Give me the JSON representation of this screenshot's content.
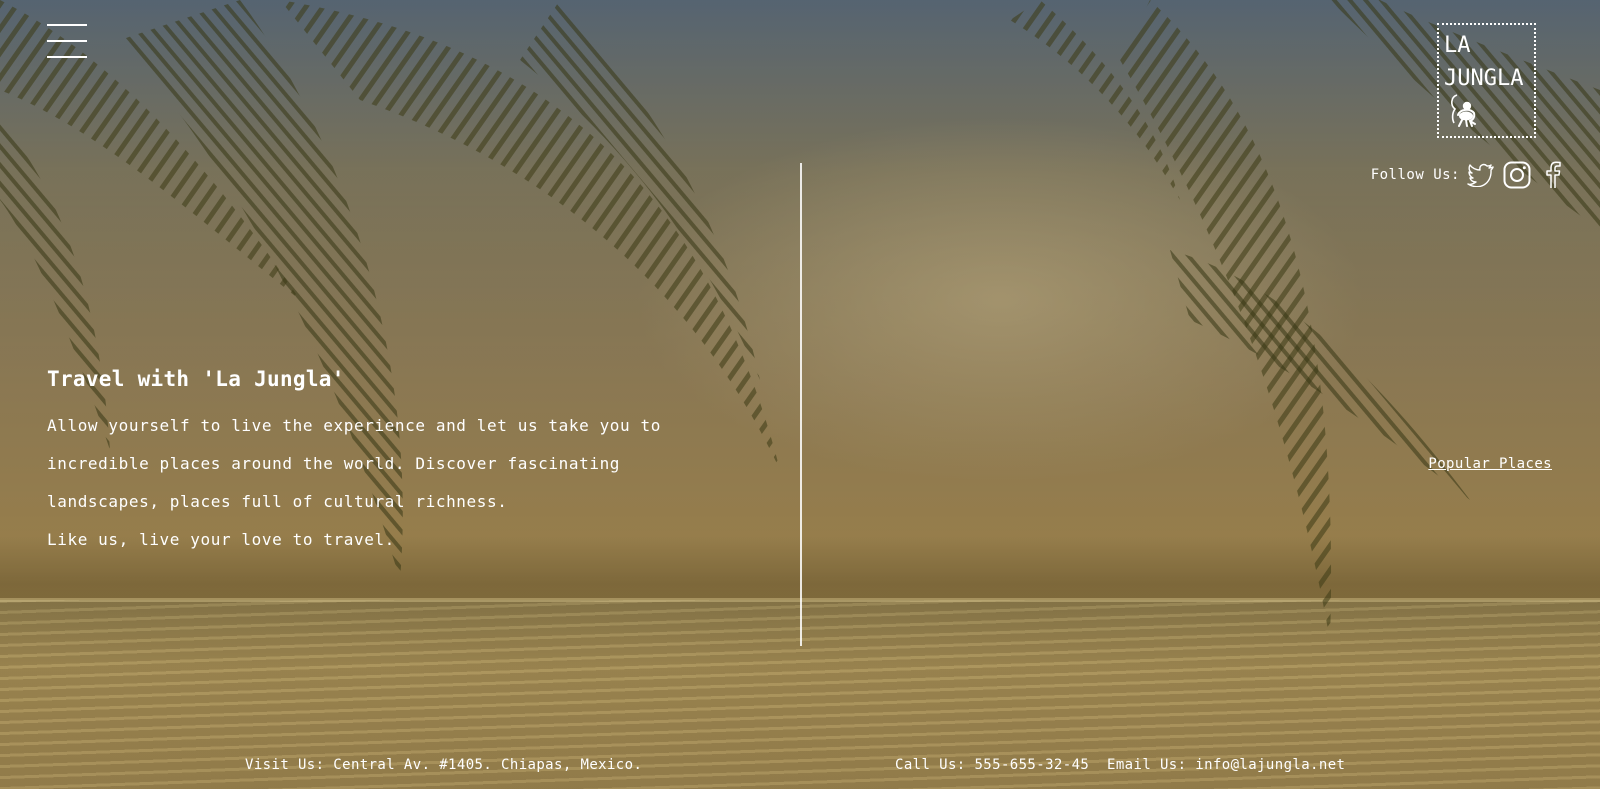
{
  "header": {
    "menu_icon": "hamburger-menu-icon",
    "logo": {
      "line1": "LA",
      "line2": "JUNGLA",
      "mascot_icon": "monkey-icon"
    }
  },
  "social": {
    "label": "Follow Us:",
    "icons": [
      "twitter-icon",
      "instagram-icon",
      "facebook-icon"
    ]
  },
  "hero": {
    "title": "Travel with 'La Jungla'",
    "paragraph_line1": "Allow yourself to live the experience and let us take you to",
    "paragraph_line2": "incredible places around the world. Discover fascinating",
    "paragraph_line3": "landscapes, places full of cultural richness.",
    "paragraph_line4": "Like us, live your love to travel."
  },
  "links": {
    "popular_places": "Popular Places"
  },
  "footer": {
    "visit": "Visit Us: Central Av. #1405. Chiapas, Mexico.",
    "call": "Call Us: 555-655-32-45",
    "email": "Email Us: info@lajungla.net"
  },
  "colors": {
    "text": "#ffffff",
    "overlay_tint": "#7d6a3e"
  }
}
